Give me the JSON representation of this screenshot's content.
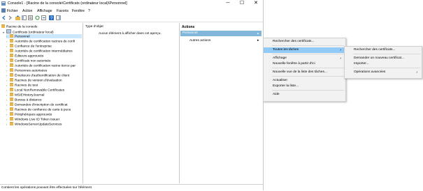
{
  "window": {
    "title": "Console1 - [Racine de la console\\Certificats (ordinateur local)\\Personnel]",
    "controls": {
      "minimize": "─",
      "maximize": "☐",
      "close": "✕"
    }
  },
  "menubar": [
    "Fichier",
    "Action",
    "Affichage",
    "Favoris",
    "Fenêtre",
    "?"
  ],
  "tree": {
    "root": "Racine de la console",
    "store": "Certificats (ordinateur local)",
    "items": [
      "Personnel",
      "Autorités de certification racines de confi",
      "Confiance de l'entreprise",
      "Autorités de certification intermédiaires",
      "Éditeurs approuvés",
      "Certificats non autorisés",
      "Autorités de certification racine tierce par",
      "Personnes autorisées",
      "Émetteurs d'authentification de client",
      "Racines de version d'évaluation",
      "Racines de test",
      "Local NonRemovable Certificates",
      "MSIEHistoryJournal",
      "Bureau à distance",
      "Demandes d'inscription de certificat",
      "Racines de confiance de carte à puce",
      "Périphériques approuvés",
      "Windows Live ID Token Issuer",
      "WindowsServerUpdateServices"
    ]
  },
  "middle": {
    "header": "Type d'objet",
    "empty_message": "Aucun élément à afficher dans cet aperçu."
  },
  "actions": {
    "header": "Actions",
    "selected": "Personnel",
    "other": "Autres actions"
  },
  "context_menu": {
    "items": [
      "Rechercher des certificats...",
      "Toutes les tâches",
      "Affichage",
      "Nouvelle fenêtre à partir d'ici",
      "Nouvelle vue de la liste des tâches...",
      "Actualiser",
      "Exporter la liste...",
      "Aide"
    ]
  },
  "submenu": {
    "items": [
      "Rechercher des certificats...",
      "Demander un nouveau certificat...",
      "Importer...",
      "Opérations avancées"
    ]
  },
  "status": "Contient les opérations pouvant être effectuées sur l'élément.",
  "colors": {
    "selection": "#cce8ff",
    "menu_highlight": "#91c9f7",
    "action_header": "#7fb6d9",
    "folder": "#e8b64c"
  }
}
